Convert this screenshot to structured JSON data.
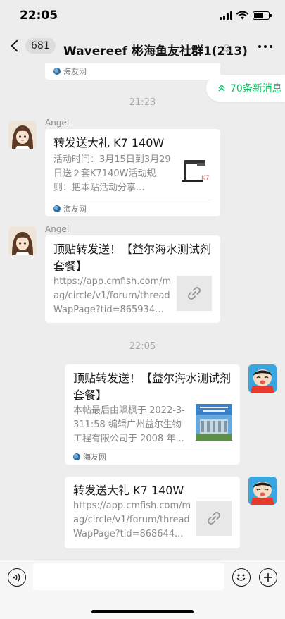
{
  "status_bar": {
    "time": "22:05"
  },
  "nav": {
    "unread_count": "681",
    "title": "Wavereef 彬海鱼友社群1(213)"
  },
  "new_messages": {
    "label": "70条新消息"
  },
  "messages": [
    {
      "type": "card_partial",
      "source": "海友网"
    },
    {
      "type": "time",
      "text": "21:23"
    },
    {
      "sender": "Angel",
      "title": "转发送大礼  K7 140W",
      "desc": "活动时间：3月15日到3月29日送２套K7140W活动规则：把本贴活动分享...",
      "source": "海友网",
      "thumb_caption": "K7"
    },
    {
      "sender": "Angel",
      "title": "顶贴转发送！【益尔海水测试剂套餐】",
      "desc": "https://app.cmfish.com/mag/circle/v1/forum/threadWapPage?tid=865934..."
    },
    {
      "type": "time",
      "text": "22:05"
    },
    {
      "title": "顶贴转发送！【益尔海水测试剂套餐】",
      "desc": "本帖最后由飒枫于 2022-3-311:58 编辑广州益尔生物工程有限公司于 2008 年...",
      "source": "海友网"
    },
    {
      "title": "转发送大礼 K7 140W",
      "desc": "https://app.cmfish.com/mag/circle/v1/forum/threadWapPage?tid=868644..."
    }
  ]
}
